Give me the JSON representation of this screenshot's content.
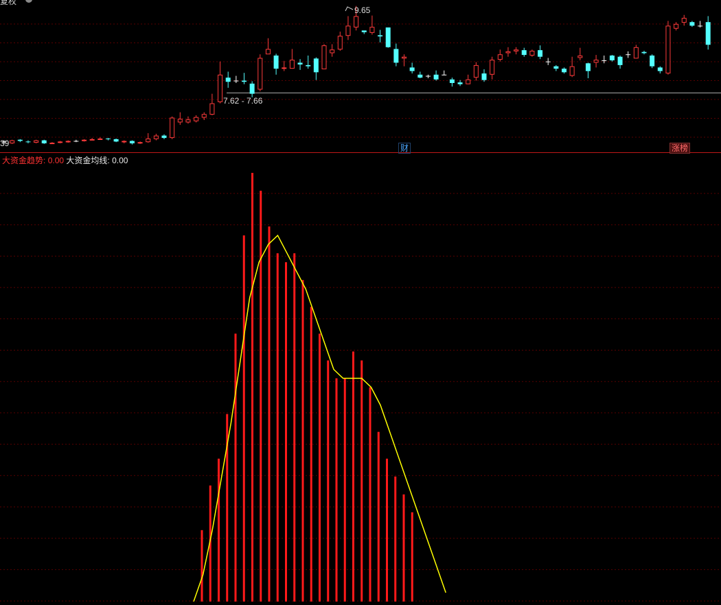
{
  "window": {
    "title_fragment": "复权"
  },
  "price_panel": {
    "high_label": "9.65",
    "range_label": "7.62 - 7.66",
    "left_edge_label": "39",
    "event_markers": [
      {
        "text": "财",
        "color": "#4aa6ff"
      },
      {
        "text": "涨榜",
        "color": "#ff5a5a"
      }
    ]
  },
  "indicator_panel": {
    "legend": [
      {
        "name": "大资金趋势",
        "value": "0.00",
        "color": "#ff2020"
      },
      {
        "name": "大资金均线",
        "value": "0.00",
        "color": "#ffff00"
      }
    ]
  },
  "colors": {
    "background": "#000000",
    "up": "#ff3b3b",
    "down": "#54ffff",
    "doji": "#ffffff",
    "grid": "#5a0000",
    "bar": "#ff1a1a",
    "line": "#ffff00"
  },
  "chart_data": [
    {
      "type": "candlestick",
      "title": "",
      "ylim": [
        7.2,
        9.75
      ],
      "annotations": [
        {
          "text": "9.65",
          "value": 9.65
        },
        {
          "text": "7.62 - 7.66",
          "value_range": [
            7.62,
            7.66
          ]
        }
      ],
      "candles": [
        [
          7.38,
          7.38,
          7.34,
          7.4
        ],
        [
          7.35,
          7.4,
          7.34,
          7.41
        ],
        [
          7.41,
          7.39,
          7.37,
          7.42
        ],
        [
          7.38,
          7.37,
          7.35,
          7.4
        ],
        [
          7.36,
          7.4,
          7.35,
          7.41
        ],
        [
          7.4,
          7.35,
          7.34,
          7.41
        ],
        [
          7.35,
          7.36,
          7.34,
          7.37
        ],
        [
          7.36,
          7.38,
          7.35,
          7.39
        ],
        [
          7.37,
          7.39,
          7.36,
          7.4
        ],
        [
          7.39,
          7.39,
          7.37,
          7.41
        ],
        [
          7.39,
          7.41,
          7.38,
          7.42
        ],
        [
          7.41,
          7.42,
          7.4,
          7.44
        ],
        [
          7.42,
          7.43,
          7.41,
          7.45
        ],
        [
          7.43,
          7.42,
          7.4,
          7.44
        ],
        [
          7.42,
          7.38,
          7.37,
          7.43
        ],
        [
          7.37,
          7.39,
          7.35,
          7.4
        ],
        [
          7.39,
          7.35,
          7.33,
          7.4
        ],
        [
          7.35,
          7.37,
          7.34,
          7.38
        ],
        [
          7.37,
          7.43,
          7.36,
          7.52
        ],
        [
          7.42,
          7.48,
          7.4,
          7.51
        ],
        [
          7.48,
          7.44,
          7.42,
          7.5
        ],
        [
          7.44,
          7.78,
          7.42,
          7.8
        ],
        [
          7.7,
          7.76,
          7.66,
          7.87
        ],
        [
          7.7,
          7.75,
          7.68,
          7.8
        ],
        [
          7.72,
          7.79,
          7.7,
          7.82
        ],
        [
          7.78,
          7.84,
          7.74,
          7.87
        ],
        [
          7.83,
          8.02,
          7.82,
          8.18
        ],
        [
          8.04,
          8.5,
          8.02,
          8.72
        ],
        [
          8.45,
          8.38,
          8.28,
          8.55
        ],
        [
          8.4,
          8.4,
          8.36,
          8.48
        ],
        [
          8.4,
          8.38,
          8.34,
          8.53
        ],
        [
          8.35,
          8.18,
          8.12,
          8.39
        ],
        [
          8.25,
          8.78,
          8.22,
          8.84
        ],
        [
          8.84,
          8.93,
          8.85,
          9.11
        ],
        [
          8.82,
          8.6,
          8.5,
          8.85
        ],
        [
          8.6,
          8.62,
          8.56,
          8.73
        ],
        [
          8.6,
          8.75,
          8.6,
          8.93
        ],
        [
          8.7,
          8.67,
          8.58,
          8.76
        ],
        [
          8.66,
          8.64,
          8.6,
          8.82
        ],
        [
          8.77,
          8.54,
          8.41,
          8.79
        ],
        [
          8.59,
          8.99,
          8.6,
          9.01
        ],
        [
          8.86,
          8.92,
          8.8,
          9.01
        ],
        [
          8.92,
          9.15,
          8.9,
          9.22
        ],
        [
          9.15,
          9.32,
          9.08,
          9.48
        ],
        [
          9.29,
          9.48,
          9.24,
          9.65
        ],
        [
          9.24,
          9.21,
          9.18,
          9.23
        ],
        [
          9.2,
          9.3,
          9.17,
          9.49
        ],
        [
          9.16,
          9.14,
          9.04,
          9.25
        ],
        [
          9.29,
          8.96,
          8.95,
          9.29
        ],
        [
          8.93,
          8.7,
          8.64,
          9.02
        ],
        [
          8.77,
          8.8,
          8.64,
          8.84
        ],
        [
          8.62,
          8.56,
          8.52,
          8.7
        ],
        [
          8.5,
          8.45,
          8.44,
          8.55
        ],
        [
          8.48,
          8.48,
          8.44,
          8.5
        ],
        [
          8.5,
          8.42,
          8.4,
          8.57
        ],
        [
          8.5,
          8.5,
          8.49,
          8.57
        ],
        [
          8.42,
          8.36,
          8.3,
          8.45
        ],
        [
          8.37,
          8.34,
          8.31,
          8.41
        ],
        [
          8.34,
          8.42,
          8.34,
          8.5
        ],
        [
          8.45,
          8.66,
          8.4,
          8.71
        ],
        [
          8.52,
          8.41,
          8.38,
          8.59
        ],
        [
          8.5,
          8.75,
          8.42,
          8.8
        ],
        [
          8.75,
          8.84,
          8.72,
          8.92
        ],
        [
          8.86,
          8.89,
          8.8,
          8.96
        ],
        [
          8.89,
          8.92,
          8.84,
          8.96
        ],
        [
          8.91,
          8.83,
          8.8,
          8.95
        ],
        [
          8.82,
          8.9,
          8.8,
          8.92
        ],
        [
          8.91,
          8.8,
          8.76,
          8.99
        ],
        [
          8.72,
          8.72,
          8.66,
          8.78
        ],
        [
          8.64,
          8.6,
          8.56,
          8.66
        ],
        [
          8.6,
          8.54,
          8.52,
          8.62
        ],
        [
          8.48,
          8.64,
          8.46,
          8.8
        ],
        [
          8.78,
          8.82,
          8.74,
          8.95
        ],
        [
          8.69,
          8.56,
          8.44,
          8.7
        ],
        [
          8.7,
          8.75,
          8.62,
          8.83
        ],
        [
          8.74,
          8.74,
          8.69,
          8.82
        ],
        [
          8.82,
          8.74,
          8.72,
          8.83
        ],
        [
          8.8,
          8.66,
          8.6,
          8.82
        ],
        [
          8.84,
          8.84,
          8.78,
          8.89
        ],
        [
          8.77,
          8.96,
          8.77,
          9.0
        ],
        [
          8.88,
          8.86,
          8.84,
          8.9
        ],
        [
          8.82,
          8.64,
          8.61,
          8.84
        ],
        [
          8.62,
          8.56,
          8.52,
          8.64
        ],
        [
          8.52,
          9.32,
          8.5,
          9.4
        ],
        [
          9.27,
          9.35,
          9.24,
          9.38
        ],
        [
          9.37,
          9.45,
          9.32,
          9.5
        ],
        [
          9.38,
          9.32,
          9.3,
          9.4
        ],
        [
          9.32,
          9.32,
          9.29,
          9.4
        ],
        [
          9.38,
          9.0,
          8.92,
          9.48
        ]
      ]
    },
    {
      "type": "bar",
      "title": "",
      "series": [
        {
          "name": "大资金趋势",
          "type": "bar",
          "values": [
            8,
            13,
            16,
            21,
            30,
            41,
            48,
            46,
            42,
            39,
            38,
            39,
            36,
            33,
            30,
            27,
            25,
            25,
            28,
            27,
            24,
            19,
            16,
            14,
            12,
            10
          ]
        },
        {
          "name": "大资金均线",
          "type": "line",
          "values": [
            0,
            3,
            8,
            14,
            20,
            27,
            34,
            38,
            40,
            41,
            39,
            37,
            35,
            32,
            29,
            26,
            25,
            25,
            25,
            24,
            22,
            19,
            16,
            13,
            10,
            7,
            4,
            1
          ]
        }
      ],
      "ylim": [
        0,
        50
      ]
    }
  ]
}
